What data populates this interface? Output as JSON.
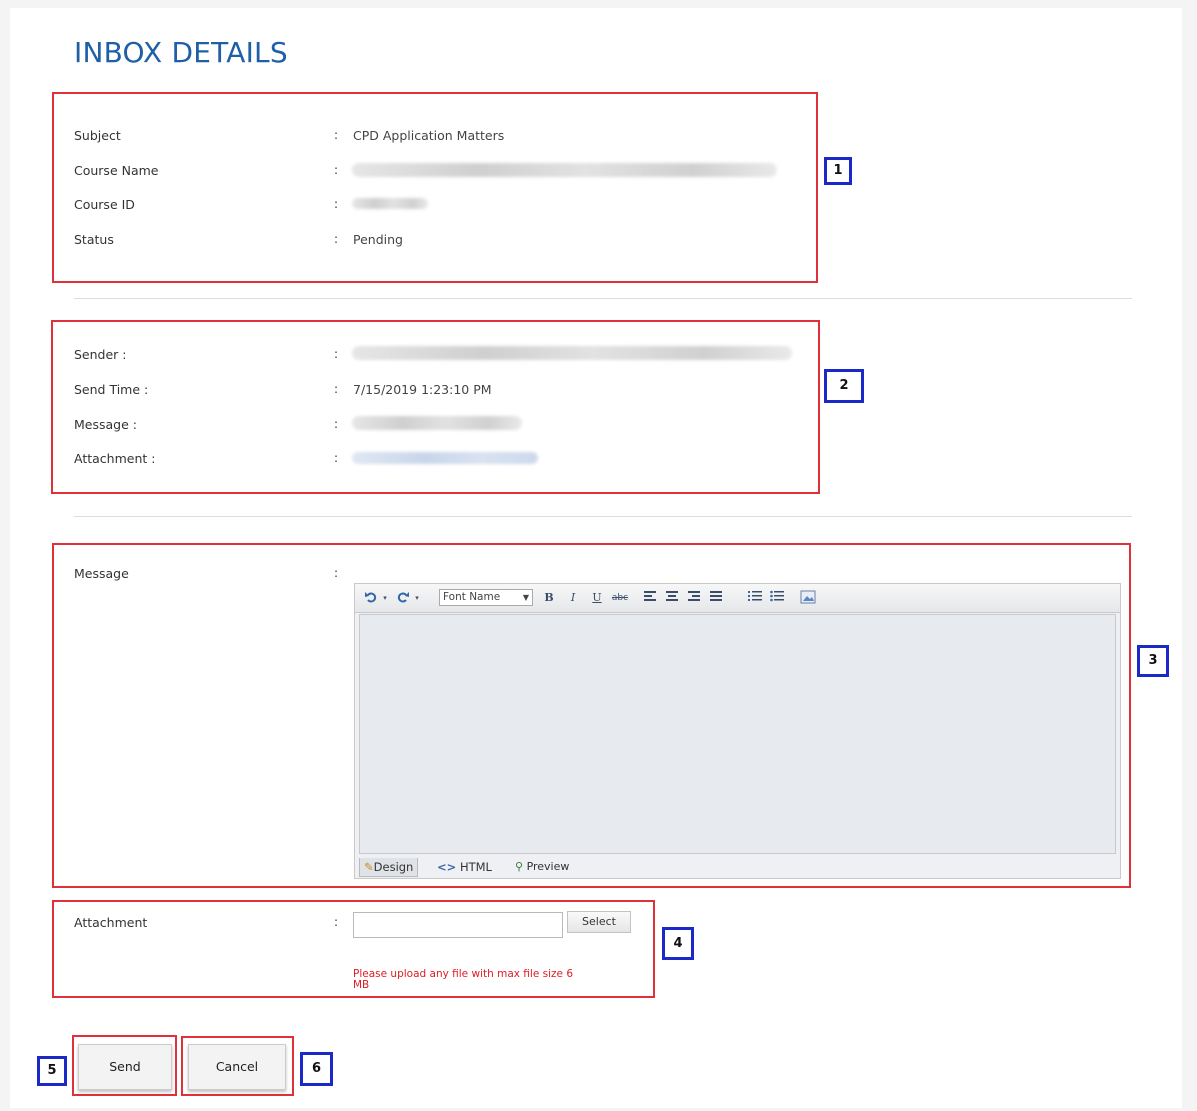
{
  "page": {
    "title": "INBOX DETAILS"
  },
  "details": {
    "subject_label": "Subject",
    "subject_value": "CPD Application Matters",
    "course_name_label": "Course Name",
    "course_id_label": "Course ID",
    "status_label": "Status",
    "status_value": "Pending"
  },
  "sender": {
    "sender_label": "Sender :",
    "send_time_label": "Send Time :",
    "send_time_value": "7/15/2019 1:23:10 PM",
    "message_label": "Message :",
    "attachment_label": "Attachment :"
  },
  "reply": {
    "message_label": "Message",
    "attachment_label": "Attachment",
    "select_label": "Select",
    "upload_note": "Please upload any file with max file size 6 MB"
  },
  "editor": {
    "font_name_placeholder": "Font Name",
    "bold_label": "B",
    "italic_label": "I",
    "underline_label": "U",
    "strike_label": "abc",
    "modes": [
      "Design",
      "HTML",
      "Preview"
    ],
    "active_mode": "Design"
  },
  "buttons": {
    "send_label": "Send",
    "cancel_label": "Cancel"
  },
  "colon": ":",
  "annotations": [
    "1",
    "2",
    "3",
    "4",
    "5",
    "6"
  ],
  "colors": {
    "title": "#1f5fa8",
    "highlight_box": "#e0303a",
    "number_box": "#1a29c7",
    "warning": "#e01b24"
  }
}
